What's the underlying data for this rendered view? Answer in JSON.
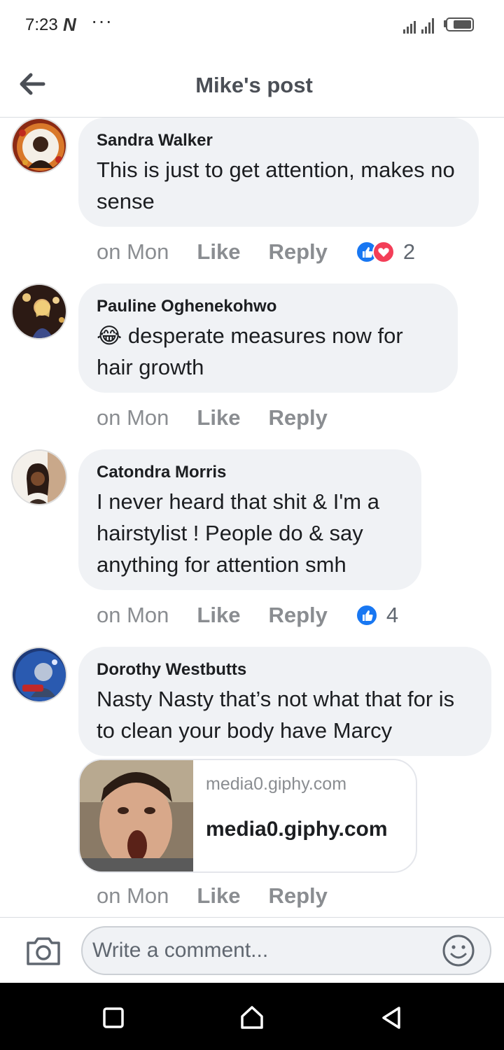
{
  "status_bar": {
    "time": "7:23",
    "app_indicator": "N",
    "more": "···",
    "icons": [
      "signal-icon",
      "signal-icon-2",
      "battery-icon"
    ]
  },
  "header": {
    "title": "Mike's post",
    "back_icon": "back-arrow-icon"
  },
  "comments": [
    {
      "author": "Sandra Walker",
      "text": "This is just to get attention, makes no sense",
      "time": "on Mon",
      "like_label": "Like",
      "reply_label": "Reply",
      "reactions": [
        "like",
        "love"
      ],
      "reaction_count": "2"
    },
    {
      "author": "Pauline Oghenekohwo",
      "emoji": "😂",
      "text": "desperate measures now for hair growth",
      "time": "on Mon",
      "like_label": "Like",
      "reply_label": "Reply"
    },
    {
      "author": "Catondra Morris",
      "text": "I never heard that shit & I'm a hairstylist ! People do & say anything for attention smh",
      "time": "on Mon",
      "like_label": "Like",
      "reply_label": "Reply",
      "reactions": [
        "like"
      ],
      "reaction_count": "4"
    },
    {
      "author": "Dorothy Westbutts",
      "text": "Nasty Nasty that’s not what that for is to clean your body have Marcy",
      "time": "on Mon",
      "like_label": "Like",
      "reply_label": "Reply",
      "link_preview": {
        "domain": "media0.giphy.com",
        "title": "media0.giphy.com"
      }
    }
  ],
  "composer": {
    "placeholder": "Write a comment...",
    "camera_icon": "camera-icon",
    "emoji_icon": "smiley-icon"
  },
  "colors": {
    "bubble": "#f0f2f5",
    "like_blue": "#1877f2",
    "love_red": "#f33e58",
    "muted_text": "#8a8d91"
  }
}
